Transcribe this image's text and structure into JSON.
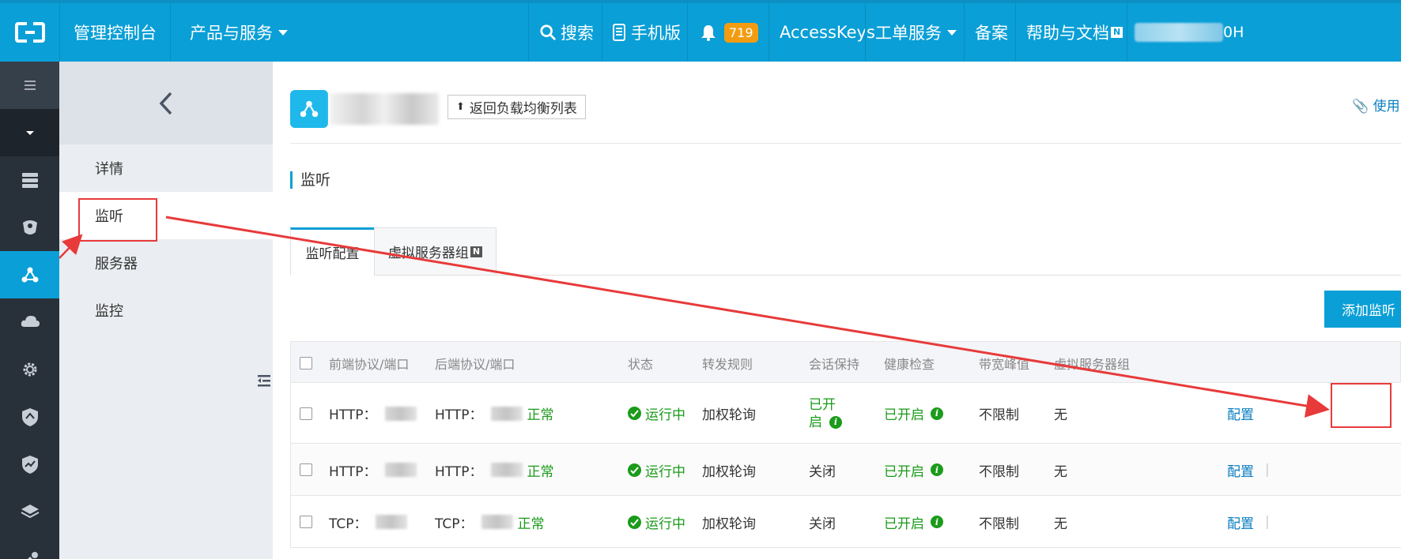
{
  "topbar": {
    "console": "管理控制台",
    "products": "产品与服务",
    "search": "搜索",
    "mobile": "手机版",
    "notifications_count": "719",
    "access_keys": "AccessKeys",
    "tickets": "工单服务",
    "filing": "备案",
    "help": "帮助与文档",
    "new_tag": "N",
    "user_suffix": "0H"
  },
  "subnav": {
    "items": [
      {
        "label": "详情"
      },
      {
        "label": "监听"
      },
      {
        "label": "服务器"
      },
      {
        "label": "监控"
      }
    ]
  },
  "header": {
    "back_label": "返回负载均衡列表",
    "usage_link": "使用"
  },
  "section": {
    "title": "监听"
  },
  "tabs": [
    {
      "label": "监听配置"
    },
    {
      "label": "虚拟服务器组",
      "tag": "N"
    }
  ],
  "toolbar": {
    "add_label": "添加监听"
  },
  "table": {
    "columns": [
      "前端协议/端口",
      "后端协议/端口",
      "状态",
      "转发规则",
      "会话保持",
      "健康检查",
      "带宽峰值",
      "虚拟服务器组"
    ],
    "rows": [
      {
        "front": "HTTP：",
        "back": "HTTP：",
        "back_status": "正常",
        "status": "运行中",
        "rule": "加权轮询",
        "session": "已开启",
        "session_line1": "已开",
        "session_line2": "启",
        "health": "已开启",
        "bandwidth": "不限制",
        "vgroup": "无",
        "action": "配置"
      },
      {
        "front": "HTTP：",
        "back": "HTTP：",
        "back_status": "正常",
        "status": "运行中",
        "rule": "加权轮询",
        "session": "关闭",
        "health": "已开启",
        "bandwidth": "不限制",
        "vgroup": "无",
        "action": "配置",
        "sep": "|"
      },
      {
        "front": "TCP：",
        "back": "TCP：",
        "back_status": "正常",
        "status": "运行中",
        "rule": "加权轮询",
        "session": "关闭",
        "health": "已开启",
        "bandwidth": "不限制",
        "vgroup": "无",
        "action": "配置",
        "sep": "|"
      }
    ]
  },
  "colors": {
    "topbar": "#0a9fd6",
    "sidebar": "#283039",
    "success": "#1a9b1a",
    "link": "#0a7ec2",
    "annotation": "#e83a3a"
  },
  "icons": {
    "info": "i"
  }
}
